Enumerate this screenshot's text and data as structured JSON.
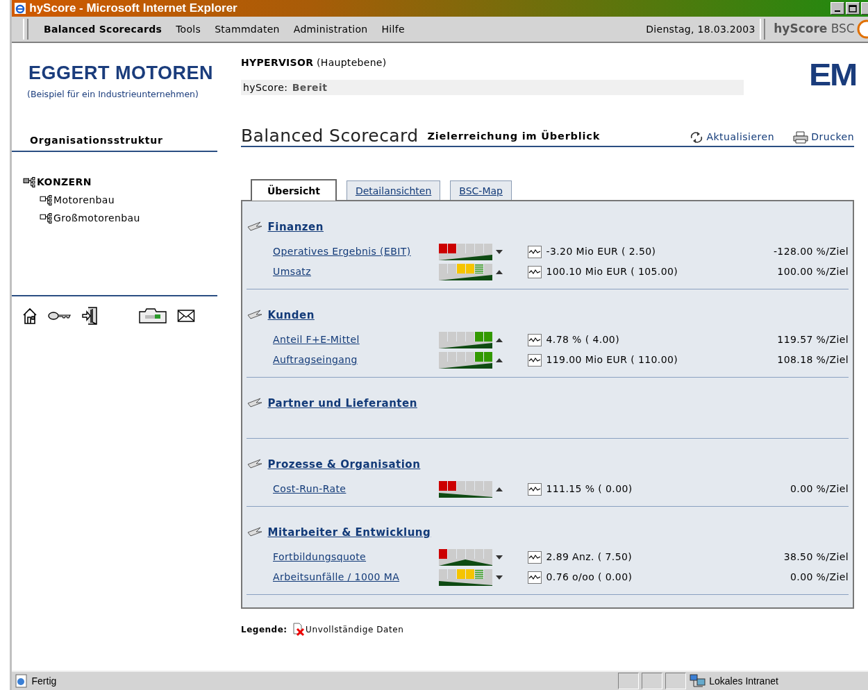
{
  "window": {
    "title": "hyScore - Microsoft Internet Explorer"
  },
  "menu": {
    "items": [
      {
        "label": "Balanced Scorecards",
        "bold": true
      },
      {
        "label": "Tools",
        "bold": false
      },
      {
        "label": "Stammdaten",
        "bold": false
      },
      {
        "label": "Administration",
        "bold": false
      },
      {
        "label": "Hilfe",
        "bold": false
      }
    ],
    "date": "Dienstag, 18.03.2003",
    "brand_bold": "hyScore",
    "brand_light": "BSC"
  },
  "company": {
    "name": "EGGERT MOTOREN",
    "subtitle": "(Beispiel für ein Industrieunternehmen)",
    "logo": "EM"
  },
  "user": {
    "role": "HYPERVISOR",
    "level": "(Hauptebene)",
    "status_label": "hyScore:",
    "status_value": "Bereit"
  },
  "sidebar": {
    "title": "Organisationsstruktur",
    "tree": [
      {
        "label": "KONZERN",
        "selected": true,
        "children": [
          {
            "label": "Motorenbau",
            "selected": false
          },
          {
            "label": "Großmotorenbau",
            "selected": false
          }
        ]
      }
    ]
  },
  "page": {
    "title": "Balanced Scorecard",
    "subtitle": "Zielerreichung im Überblick",
    "actions": [
      "Aktualisieren",
      "Drucken"
    ]
  },
  "tabs": [
    {
      "label": "Übersicht",
      "selected": true
    },
    {
      "label": "Detailansichten",
      "selected": false
    },
    {
      "label": "BSC-Map",
      "selected": false
    }
  ],
  "perspectives": [
    {
      "title": "Finanzen",
      "metrics": [
        {
          "name": "Operatives Ergebnis (EBIT)",
          "segments": [
            {
              "kind": "lit",
              "color": "#cc0000"
            },
            {
              "kind": "lit",
              "color": "#cc0000"
            },
            {
              "kind": "off"
            },
            {
              "kind": "off"
            },
            {
              "kind": "off"
            },
            {
              "kind": "off"
            }
          ],
          "ramp": {
            "kind": "rising"
          },
          "trend": {
            "kind": "down"
          },
          "value": "-3.20 Mio EUR ( 2.50)",
          "percent": "-128.00 %/Ziel"
        },
        {
          "name": "Umsatz",
          "segments": [
            {
              "kind": "off"
            },
            {
              "kind": "off"
            },
            {
              "kind": "lit",
              "color": "#f5c400"
            },
            {
              "kind": "lit",
              "color": "#f5c400"
            },
            {
              "kind": "striped",
              "color": "#44aa33"
            },
            {
              "kind": "off"
            }
          ],
          "ramp": {
            "kind": "rising"
          },
          "trend": {
            "kind": "up"
          },
          "value": "100.10 Mio EUR ( 105.00)",
          "percent": "100.00 %/Ziel"
        }
      ]
    },
    {
      "title": "Kunden",
      "metrics": [
        {
          "name": "Anteil F+E-Mittel",
          "segments": [
            {
              "kind": "off"
            },
            {
              "kind": "off"
            },
            {
              "kind": "off"
            },
            {
              "kind": "off"
            },
            {
              "kind": "lit",
              "color": "#339900"
            },
            {
              "kind": "lit",
              "color": "#339900"
            }
          ],
          "ramp": {
            "kind": "rising"
          },
          "trend": {
            "kind": "up"
          },
          "value": "4.78 % ( 4.00)",
          "percent": "119.57 %/Ziel"
        },
        {
          "name": "Auftragseingang",
          "segments": [
            {
              "kind": "off"
            },
            {
              "kind": "off"
            },
            {
              "kind": "off"
            },
            {
              "kind": "off"
            },
            {
              "kind": "lit",
              "color": "#339900"
            },
            {
              "kind": "lit",
              "color": "#339900"
            }
          ],
          "ramp": {
            "kind": "rising"
          },
          "trend": {
            "kind": "up"
          },
          "value": "119.00 Mio EUR ( 110.00)",
          "percent": "108.18 %/Ziel"
        }
      ]
    },
    {
      "title": "Partner und Lieferanten"
    },
    {
      "title": "Prozesse & Organisation",
      "metrics": [
        {
          "name": "Cost-Run-Rate",
          "segments": [
            {
              "kind": "lit",
              "color": "#cc0000"
            },
            {
              "kind": "lit",
              "color": "#cc0000"
            },
            {
              "kind": "off"
            },
            {
              "kind": "off"
            },
            {
              "kind": "off"
            },
            {
              "kind": "off"
            }
          ],
          "ramp": {
            "kind": "falling"
          },
          "trend": {
            "kind": "up"
          },
          "value": "111.15 % ( 0.00)",
          "percent": "0.00 %/Ziel"
        }
      ]
    },
    {
      "title": "Mitarbeiter & Entwicklung",
      "metrics": [
        {
          "name": "Fortbildungsquote",
          "segments": [
            {
              "kind": "lit",
              "color": "#cc0000"
            },
            {
              "kind": "off"
            },
            {
              "kind": "off"
            },
            {
              "kind": "off"
            },
            {
              "kind": "off"
            },
            {
              "kind": "off"
            }
          ],
          "ramp": {
            "kind": "peak"
          },
          "trend": {
            "kind": "down"
          },
          "value": "2.89 Anz. ( 7.50)",
          "percent": "38.50 %/Ziel"
        },
        {
          "name": "Arbeitsunfälle / 1000 MA",
          "segments": [
            {
              "kind": "off"
            },
            {
              "kind": "off"
            },
            {
              "kind": "lit",
              "color": "#f5c400"
            },
            {
              "kind": "lit",
              "color": "#f5c400"
            },
            {
              "kind": "striped",
              "color": "#44aa33"
            },
            {
              "kind": "off"
            }
          ],
          "ramp": {
            "kind": "falling"
          },
          "trend": {
            "kind": "down"
          },
          "value": "0.76 o/oo ( 0.00)",
          "percent": "0.00 %/Ziel"
        }
      ]
    }
  ],
  "legend": {
    "label": "Legende:",
    "text": "Unvollständige Daten"
  },
  "status_bar": {
    "text": "Fertig",
    "zone": "Lokales Intranet"
  }
}
